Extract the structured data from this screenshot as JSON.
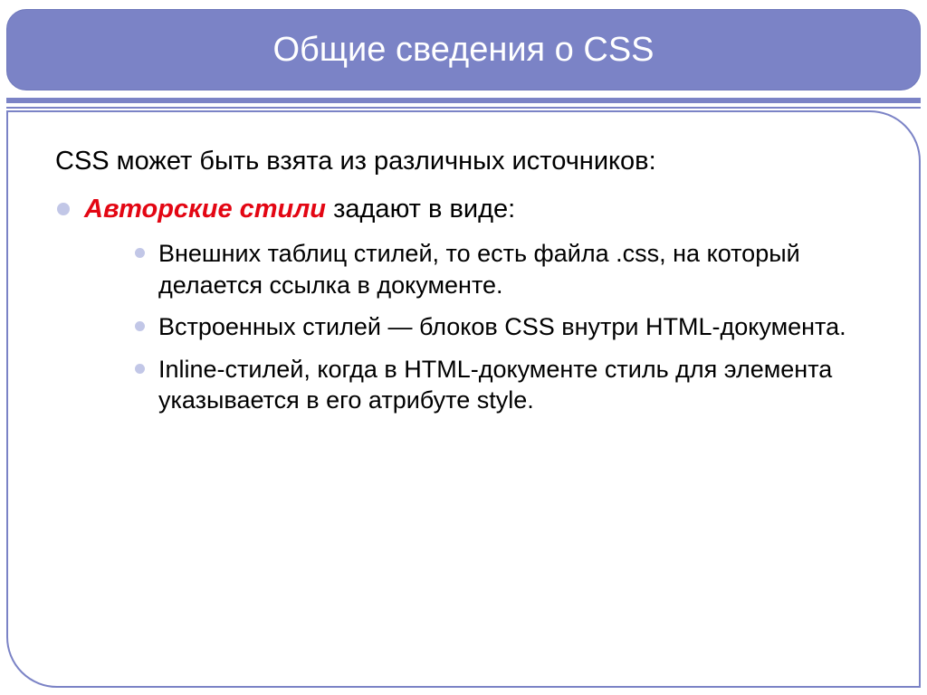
{
  "title": "Общие сведения о CSS",
  "intro": "CSS может быть взята из различных источников:",
  "main": {
    "emphasis": "Авторские стили",
    "rest": " задают в виде:"
  },
  "sub": [
    "Внешних таблиц стилей, то есть файла .css, на который делается ссылка в документе.",
    "Встроенных стилей — блоков CSS внутри HTML-документа.",
    "Inline-стилей, когда в HTML-документе стиль для элемента указывается в его атрибуте style."
  ]
}
